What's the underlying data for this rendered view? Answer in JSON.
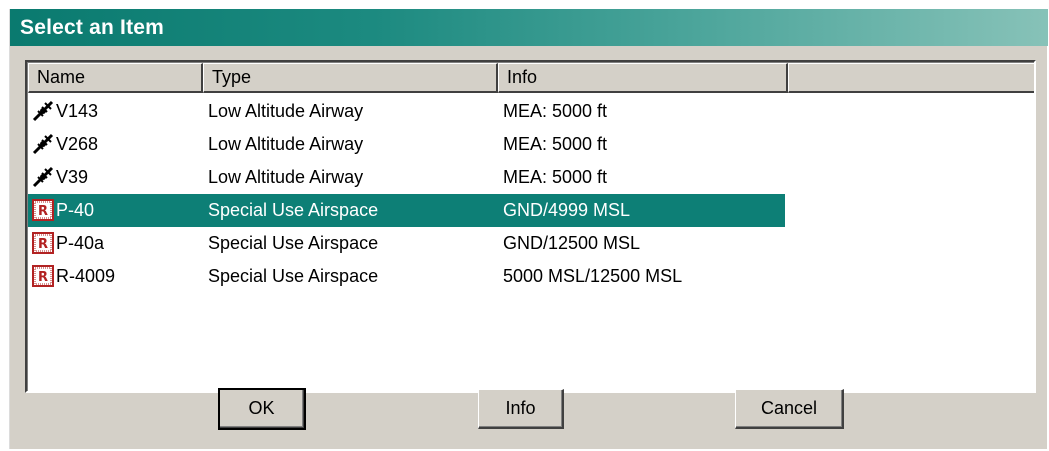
{
  "window": {
    "title": "Select an Item"
  },
  "list": {
    "columns": [
      "Name",
      "Type",
      "Info",
      ""
    ],
    "rows": [
      {
        "icon": "airway-icon",
        "name": "V143",
        "type": "Low Altitude Airway",
        "info": "MEA: 5000 ft",
        "selected": false
      },
      {
        "icon": "airway-icon",
        "name": "V268",
        "type": "Low Altitude Airway",
        "info": "MEA: 5000 ft",
        "selected": false
      },
      {
        "icon": "airway-icon",
        "name": "V39",
        "type": "Low Altitude Airway",
        "info": "MEA: 5000 ft",
        "selected": false
      },
      {
        "icon": "restricted-airspace-icon",
        "name": "P-40",
        "type": "Special Use Airspace",
        "info": "GND/4999 MSL",
        "selected": true
      },
      {
        "icon": "restricted-airspace-icon",
        "name": "P-40a",
        "type": "Special Use Airspace",
        "info": "GND/12500 MSL",
        "selected": false
      },
      {
        "icon": "restricted-airspace-icon",
        "name": "R-4009",
        "type": "Special Use Airspace",
        "info": "5000 MSL/12500 MSL",
        "selected": false
      }
    ]
  },
  "buttons": {
    "ok": "OK",
    "info": "Info",
    "cancel": "Cancel"
  },
  "colors": {
    "selection": "#0d7f76",
    "face": "#d4d0c8",
    "restricted_icon": "#b22222"
  }
}
